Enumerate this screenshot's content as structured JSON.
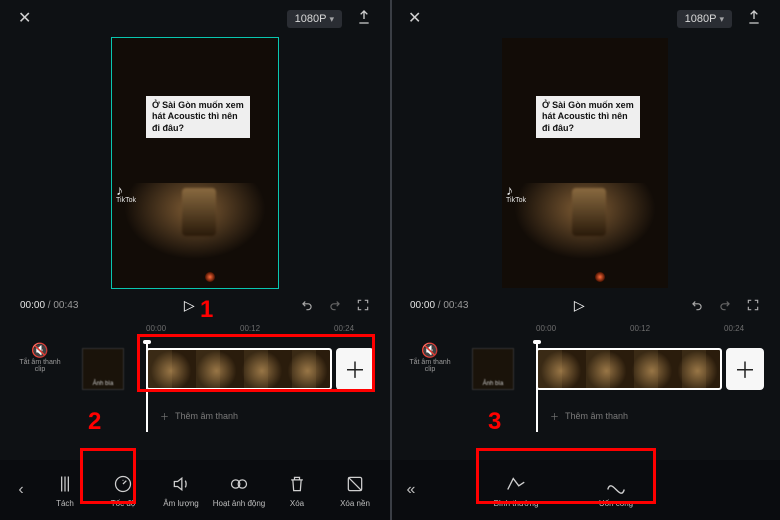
{
  "left": {
    "topbar": {
      "resolution": "1080P"
    },
    "overlay_text": "Ở Sài Gòn muốn xem hát Acoustic thì nên đi đâu?",
    "tiktok_label": "TikTok",
    "time": {
      "current": "00:00",
      "total": "00:43"
    },
    "ruler": {
      "t0": "00:00",
      "t1": "00:12",
      "t2": "00:24"
    },
    "mute_label": "Tắt âm thanh clip",
    "cover_label": "Ảnh bìa",
    "audio_row": "Thêm âm thanh",
    "tools": {
      "t1": "Tách",
      "t2": "Tốc độ",
      "t3": "Âm lượng",
      "t4": "Hoạt ảnh động",
      "t5": "Xóa",
      "t6": "Xóa nền"
    }
  },
  "right": {
    "topbar": {
      "resolution": "1080P"
    },
    "overlay_text": "Ở Sài Gòn muốn xem hát Acoustic thì nên đi đâu?",
    "tiktok_label": "TikTok",
    "time": {
      "current": "00:00",
      "total": "00:43"
    },
    "ruler": {
      "t0": "00:00",
      "t1": "00:12",
      "t2": "00:24"
    },
    "mute_label": "Tắt âm thanh clip",
    "cover_label": "Ảnh bìa",
    "audio_row": "Thêm âm thanh",
    "tools": {
      "t1": "Bình thường",
      "t2": "Uốn cong"
    }
  },
  "anno": {
    "n1": "1",
    "n2": "2",
    "n3": "3"
  }
}
